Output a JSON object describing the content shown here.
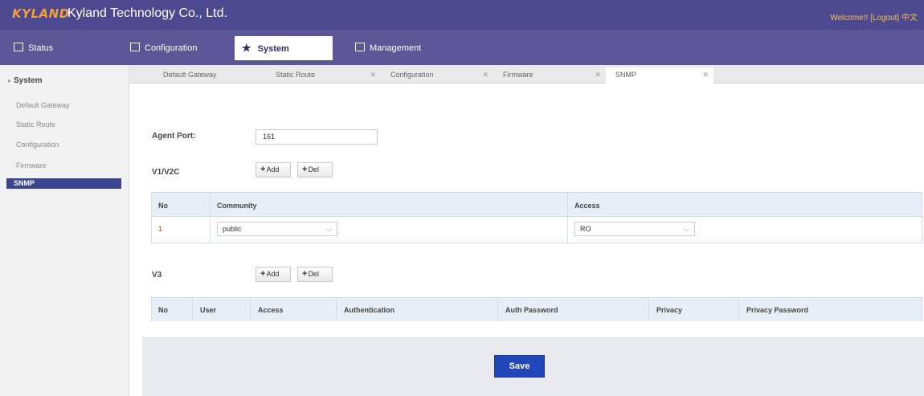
{
  "header": {
    "logo_text": "KYLAND",
    "company": "Kyland Technology Co., Ltd.",
    "welcome": "Welcome!!",
    "logout": "[Logout]",
    "language": "中文"
  },
  "main_nav": [
    {
      "label": "Status",
      "icon": "monitor-icon"
    },
    {
      "label": "Configuration",
      "icon": "config-icon"
    },
    {
      "label": "System",
      "icon": "star-icon",
      "active": true
    },
    {
      "label": "Management",
      "icon": "management-icon"
    }
  ],
  "sidebar": {
    "title": "System",
    "items": [
      {
        "label": "Default Gateway"
      },
      {
        "label": "Static Route"
      },
      {
        "label": "Configuration"
      },
      {
        "label": "Firmware"
      },
      {
        "label": "SNMP",
        "active": true
      }
    ]
  },
  "subtabs": [
    {
      "label": "Default Gateway"
    },
    {
      "label": "Static Route"
    },
    {
      "label": "Configuration"
    },
    {
      "label": "Firmware"
    },
    {
      "label": "SNMP",
      "active": true
    }
  ],
  "agent_port": {
    "label": "Agent Port:",
    "value": "161"
  },
  "v1v2c": {
    "label": "V1/V2C",
    "add_label": "Add",
    "del_label": "Del",
    "columns": [
      "No",
      "Community",
      "Access"
    ],
    "rows": [
      {
        "no": "1",
        "community": "public",
        "access": "RO"
      }
    ]
  },
  "v3": {
    "label": "V3",
    "add_label": "Add",
    "del_label": "Del",
    "columns": [
      "No",
      "User",
      "Access",
      "Authentication",
      "Auth Password",
      "Privacy",
      "Privacy Password"
    ]
  },
  "save_label": "Save",
  "colors": {
    "header": "#4d4990",
    "nav": "#5b5797",
    "sidebar_active": "#3c4590",
    "save": "#2146b9",
    "logo": "#f2a13a"
  }
}
